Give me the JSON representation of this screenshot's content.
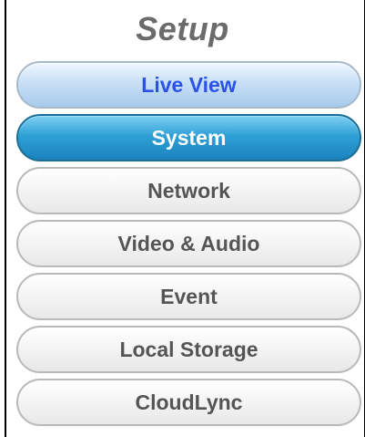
{
  "header": {
    "title": "Setup"
  },
  "menu": {
    "items": [
      {
        "label": "Live View",
        "state": "live"
      },
      {
        "label": "System",
        "state": "active"
      },
      {
        "label": "Network",
        "state": "normal"
      },
      {
        "label": "Video & Audio",
        "state": "normal"
      },
      {
        "label": "Event",
        "state": "normal"
      },
      {
        "label": "Local Storage",
        "state": "normal"
      },
      {
        "label": "CloudLync",
        "state": "normal"
      }
    ]
  },
  "colors": {
    "title": "#6b6b6b",
    "live_text": "#2a52e8",
    "active_bg": "#2fa0d6",
    "normal_text": "#555555"
  }
}
